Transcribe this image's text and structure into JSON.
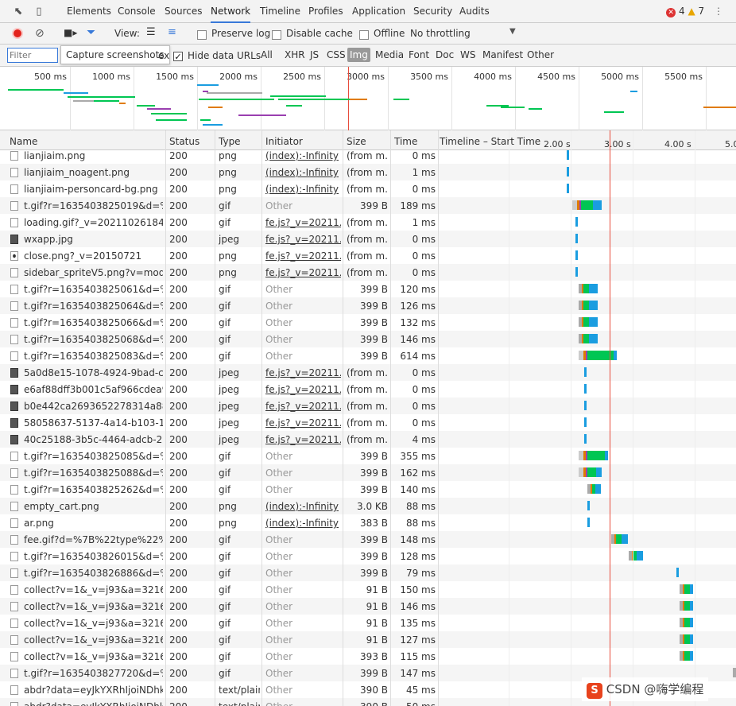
{
  "tabs": {
    "items": [
      "Elements",
      "Console",
      "Sources",
      "Network",
      "Timeline",
      "Profiles",
      "Application",
      "Security",
      "Audits"
    ],
    "active": "Network"
  },
  "badges": {
    "errors": "4",
    "warnings": "7"
  },
  "toolbar": {
    "view_label": "View:",
    "preserve_log": "Preserve log",
    "disable_cache": "Disable cache",
    "offline": "Offline",
    "throttling": "No throttling"
  },
  "filterbar": {
    "placeholder": "Filter",
    "tooltip": "Capture screenshots",
    "ex": "ex",
    "hide_data_urls": "Hide data URLs",
    "types": [
      "All",
      "XHR",
      "JS",
      "CSS",
      "Img",
      "Media",
      "Font",
      "Doc",
      "WS",
      "Manifest",
      "Other"
    ],
    "active_type": "Img"
  },
  "overview": {
    "ticks": [
      "500 ms",
      "1000 ms",
      "1500 ms",
      "2000 ms",
      "2500 ms",
      "3000 ms",
      "3500 ms",
      "4000 ms",
      "4500 ms",
      "5000 ms",
      "5500 ms",
      "6"
    ]
  },
  "table": {
    "headers": [
      "Name",
      "Status",
      "Type",
      "Initiator",
      "Size",
      "Time",
      "Timeline – Start Time"
    ],
    "timeline_ticks": [
      "2.00 s",
      "3.00 s",
      "4.00 s",
      "5.0"
    ]
  },
  "colors": {
    "waiting": "#00c653",
    "download": "#1a9de0",
    "queue": "#aaaaaa",
    "ssl": "#e07b00",
    "dns": "#9a3fb0",
    "red_line": "#e74c3c"
  },
  "rows": [
    {
      "name": "lianjiaim.png",
      "status": "200",
      "type": "png",
      "initiator": "(index):-Infinity",
      "size": "(from m...",
      "time": "0 ms",
      "icon": "image-file-icon",
      "link": true,
      "bar": {
        "start": 0.43,
        "wait": 0,
        "dl": 0.02
      }
    },
    {
      "name": "lianjiaim_noagent.png",
      "status": "200",
      "type": "png",
      "initiator": "(index):-Infinity",
      "size": "(from m...",
      "time": "1 ms",
      "icon": "image-file-icon",
      "link": true,
      "bar": {
        "start": 0.43,
        "wait": 0,
        "dl": 0.02
      }
    },
    {
      "name": "lianjiaim-personcard-bg.png",
      "status": "200",
      "type": "png",
      "initiator": "(index):-Infinity",
      "size": "(from m...",
      "time": "0 ms",
      "icon": "image-file-icon",
      "link": true,
      "bar": {
        "start": 0.43,
        "wait": 0,
        "dl": 0.02
      }
    },
    {
      "name": "t.gif?r=1635403825019&d=%7...",
      "status": "200",
      "type": "gif",
      "initiator": "Other",
      "size": "399 B",
      "time": "189 ms",
      "icon": "file-icon",
      "link": false,
      "bar": {
        "start": 0.45,
        "wait": 0.04,
        "dl": 0.03
      }
    },
    {
      "name": "loading.gif?_v=2021102618491...",
      "status": "200",
      "type": "gif",
      "initiator": "fe.js?_v=20211...",
      "size": "(from m...",
      "time": "1 ms",
      "icon": "file-icon",
      "link": true,
      "bar": {
        "start": 0.46,
        "wait": 0,
        "dl": 0.02
      }
    },
    {
      "name": "wxapp.jpg",
      "status": "200",
      "type": "jpeg",
      "initiator": "fe.js?_v=20211...",
      "size": "(from m...",
      "time": "0 ms",
      "icon": "image-thumb-icon",
      "link": true,
      "bar": {
        "start": 0.46,
        "wait": 0,
        "dl": 0.02
      }
    },
    {
      "name": "close.png?_v=20150721",
      "status": "200",
      "type": "png",
      "initiator": "fe.js?_v=20211...",
      "size": "(from m...",
      "time": "0 ms",
      "icon": "dot-file-icon",
      "link": true,
      "bar": {
        "start": 0.46,
        "wait": 0,
        "dl": 0.02
      }
    },
    {
      "name": "sidebar_spriteV5.png?v=modif...",
      "status": "200",
      "type": "png",
      "initiator": "fe.js?_v=20211...",
      "size": "(from m...",
      "time": "0 ms",
      "icon": "bar-file-icon",
      "link": true,
      "bar": {
        "start": 0.46,
        "wait": 0,
        "dl": 0.02
      }
    },
    {
      "name": "t.gif?r=1635403825061&d=%7...",
      "status": "200",
      "type": "gif",
      "initiator": "Other",
      "size": "399 B",
      "time": "120 ms",
      "icon": "file-icon",
      "link": false,
      "bar": {
        "start": 0.47,
        "wait": 0.02,
        "dl": 0.03
      }
    },
    {
      "name": "t.gif?r=1635403825064&d=%7...",
      "status": "200",
      "type": "gif",
      "initiator": "Other",
      "size": "399 B",
      "time": "126 ms",
      "icon": "file-icon",
      "link": false,
      "bar": {
        "start": 0.47,
        "wait": 0.02,
        "dl": 0.03
      }
    },
    {
      "name": "t.gif?r=1635403825066&d=%7...",
      "status": "200",
      "type": "gif",
      "initiator": "Other",
      "size": "399 B",
      "time": "132 ms",
      "icon": "file-icon",
      "link": false,
      "bar": {
        "start": 0.47,
        "wait": 0.02,
        "dl": 0.03
      }
    },
    {
      "name": "t.gif?r=1635403825068&d=%7...",
      "status": "200",
      "type": "gif",
      "initiator": "Other",
      "size": "399 B",
      "time": "146 ms",
      "icon": "file-icon",
      "link": false,
      "bar": {
        "start": 0.47,
        "wait": 0.02,
        "dl": 0.03
      }
    },
    {
      "name": "t.gif?r=1635403825083&d=%7...",
      "status": "200",
      "type": "gif",
      "initiator": "Other",
      "size": "399 B",
      "time": "614 ms",
      "icon": "file-icon",
      "link": false,
      "bar": {
        "start": 0.47,
        "wait": 0.09,
        "dl": 0.01
      }
    },
    {
      "name": "5a0d8e15-1078-4924-9bad-c0...",
      "status": "200",
      "type": "jpeg",
      "initiator": "fe.js?_v=20211...",
      "size": "(from m...",
      "time": "0 ms",
      "icon": "image-thumb-icon",
      "link": true,
      "bar": {
        "start": 0.49,
        "wait": 0,
        "dl": 0.02
      }
    },
    {
      "name": "e6af88dff3b001c5af966cdea99...",
      "status": "200",
      "type": "jpeg",
      "initiator": "fe.js?_v=20211...",
      "size": "(from m...",
      "time": "0 ms",
      "icon": "image-thumb-icon",
      "link": true,
      "bar": {
        "start": 0.49,
        "wait": 0,
        "dl": 0.02
      }
    },
    {
      "name": "b0e442ca2693652278314a885...",
      "status": "200",
      "type": "jpeg",
      "initiator": "fe.js?_v=20211...",
      "size": "(from m...",
      "time": "0 ms",
      "icon": "image-thumb-icon",
      "link": true,
      "bar": {
        "start": 0.49,
        "wait": 0,
        "dl": 0.02
      }
    },
    {
      "name": "58058637-5137-4a14-b103-19...",
      "status": "200",
      "type": "jpeg",
      "initiator": "fe.js?_v=20211...",
      "size": "(from m...",
      "time": "0 ms",
      "icon": "image-thumb-icon",
      "link": true,
      "bar": {
        "start": 0.49,
        "wait": 0,
        "dl": 0.02
      }
    },
    {
      "name": "40c25188-3b5c-4464-adcb-23...",
      "status": "200",
      "type": "jpeg",
      "initiator": "fe.js?_v=20211...",
      "size": "(from m...",
      "time": "4 ms",
      "icon": "image-thumb-icon",
      "link": true,
      "bar": {
        "start": 0.49,
        "wait": 0,
        "dl": 0.02
      }
    },
    {
      "name": "t.gif?r=1635403825085&d=%7...",
      "status": "200",
      "type": "gif",
      "initiator": "Other",
      "size": "399 B",
      "time": "355 ms",
      "icon": "file-icon",
      "link": false,
      "bar": {
        "start": 0.47,
        "wait": 0.06,
        "dl": 0.01
      }
    },
    {
      "name": "t.gif?r=1635403825088&d=%7...",
      "status": "200",
      "type": "gif",
      "initiator": "Other",
      "size": "399 B",
      "time": "162 ms",
      "icon": "file-icon",
      "link": false,
      "bar": {
        "start": 0.47,
        "wait": 0.03,
        "dl": 0.02
      }
    },
    {
      "name": "t.gif?r=1635403825262&d=%7...",
      "status": "200",
      "type": "gif",
      "initiator": "Other",
      "size": "399 B",
      "time": "140 ms",
      "icon": "file-icon",
      "link": false,
      "bar": {
        "start": 0.5,
        "wait": 0.01,
        "dl": 0.02
      }
    },
    {
      "name": "empty_cart.png",
      "status": "200",
      "type": "png",
      "initiator": "(index):-Infinity",
      "size": "3.0 KB",
      "time": "88 ms",
      "icon": "image-file-icon",
      "link": true,
      "bar": {
        "start": 0.5,
        "wait": 0,
        "dl": 0.02
      }
    },
    {
      "name": "ar.png",
      "status": "200",
      "type": "png",
      "initiator": "(index):-Infinity",
      "size": "383 B",
      "time": "88 ms",
      "icon": "chevron-file-icon",
      "link": true,
      "bar": {
        "start": 0.5,
        "wait": 0,
        "dl": 0.02
      }
    },
    {
      "name": "fee.gif?d=%7B%22type%22%3...",
      "status": "200",
      "type": "gif",
      "initiator": "Other",
      "size": "399 B",
      "time": "148 ms",
      "icon": "file-icon",
      "link": false,
      "bar": {
        "start": 0.58,
        "wait": 0.02,
        "dl": 0.02
      }
    },
    {
      "name": "t.gif?r=1635403826015&d=%7...",
      "status": "200",
      "type": "gif",
      "initiator": "Other",
      "size": "399 B",
      "time": "128 ms",
      "icon": "file-icon",
      "link": false,
      "bar": {
        "start": 0.64,
        "wait": 0.01,
        "dl": 0.02
      }
    },
    {
      "name": "t.gif?r=1635403826886&d=%7...",
      "status": "200",
      "type": "gif",
      "initiator": "Other",
      "size": "399 B",
      "time": "79 ms",
      "icon": "file-icon",
      "link": false,
      "bar": {
        "start": 0.8,
        "wait": 0,
        "dl": 0.02
      }
    },
    {
      "name": "collect?v=1&_v=j93&a=32163...",
      "status": "200",
      "type": "gif",
      "initiator": "Other",
      "size": "91 B",
      "time": "150 ms",
      "icon": "file-icon",
      "link": false,
      "bar": {
        "start": 0.81,
        "wait": 0.02,
        "dl": 0.01
      }
    },
    {
      "name": "collect?v=1&_v=j93&a=32163...",
      "status": "200",
      "type": "gif",
      "initiator": "Other",
      "size": "91 B",
      "time": "146 ms",
      "icon": "file-icon",
      "link": false,
      "bar": {
        "start": 0.81,
        "wait": 0.02,
        "dl": 0.01
      }
    },
    {
      "name": "collect?v=1&_v=j93&a=32163...",
      "status": "200",
      "type": "gif",
      "initiator": "Other",
      "size": "91 B",
      "time": "135 ms",
      "icon": "file-icon",
      "link": false,
      "bar": {
        "start": 0.81,
        "wait": 0.02,
        "dl": 0.01
      }
    },
    {
      "name": "collect?v=1&_v=j93&a=32163...",
      "status": "200",
      "type": "gif",
      "initiator": "Other",
      "size": "91 B",
      "time": "127 ms",
      "icon": "file-icon",
      "link": false,
      "bar": {
        "start": 0.81,
        "wait": 0.02,
        "dl": 0.01
      }
    },
    {
      "name": "collect?v=1&_v=j93&a=32163...",
      "status": "200",
      "type": "gif",
      "initiator": "Other",
      "size": "393 B",
      "time": "115 ms",
      "icon": "file-icon",
      "link": false,
      "bar": {
        "start": 0.81,
        "wait": 0.02,
        "dl": 0.01
      }
    },
    {
      "name": "t.gif?r=1635403827720&d=%7...",
      "status": "200",
      "type": "gif",
      "initiator": "Other",
      "size": "399 B",
      "time": "147 ms",
      "icon": "file-icon",
      "link": false,
      "bar": {
        "start": 0.99,
        "wait": 0.01,
        "dl": 0
      }
    },
    {
      "name": "abdr?data=eyJkYXRhIjoiNDhk...",
      "status": "200",
      "type": "text/plain",
      "initiator": "Other",
      "size": "390 B",
      "time": "45 ms",
      "icon": "doc-file-icon",
      "link": false,
      "bar": null
    },
    {
      "name": "abdr?data=eyJkYXRhIjoiNDhk...",
      "status": "200",
      "type": "text/plain",
      "initiator": "Other",
      "size": "390 B",
      "time": "50 ms",
      "icon": "doc-file-icon",
      "link": false,
      "bar": null
    }
  ],
  "watermark": "CSDN @嗨学编程"
}
